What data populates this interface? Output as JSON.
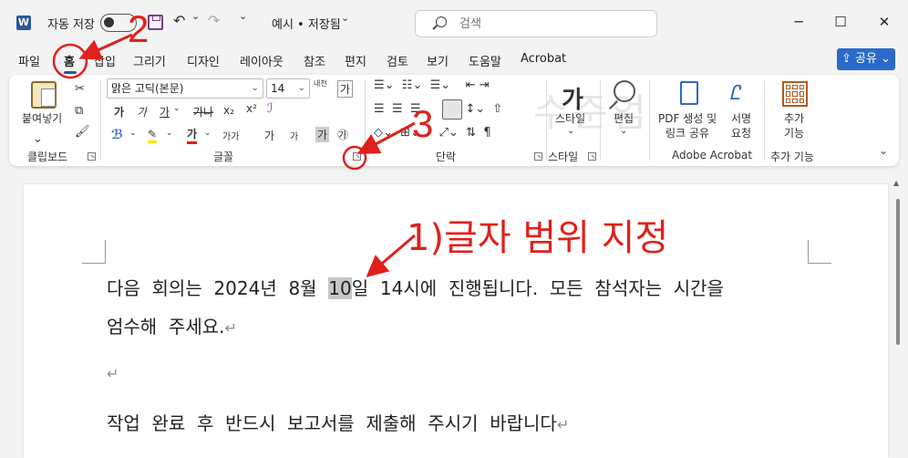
{
  "titlebar": {
    "app_logo": "W",
    "autosave_label": "자동 저장",
    "autosave_state": "off",
    "doc_title": "예시 • 저장됨",
    "search_placeholder": "검색",
    "icons": {
      "save": "save-icon",
      "undo": "↶",
      "undo_dropdown": "⌄",
      "redo": "↷",
      "customize": "⌄",
      "title_dropdown": "⌄",
      "minimize": "─",
      "maximize": "☐",
      "close": "✕"
    }
  },
  "tabs": [
    {
      "label": "파일"
    },
    {
      "label": "홈",
      "active": true
    },
    {
      "label": "삽입"
    },
    {
      "label": "그리기"
    },
    {
      "label": "디자인"
    },
    {
      "label": "레이아웃"
    },
    {
      "label": "참조"
    },
    {
      "label": "편지"
    },
    {
      "label": "검토"
    },
    {
      "label": "보기"
    },
    {
      "label": "도움말"
    },
    {
      "label": "Acrobat"
    }
  ],
  "share_label": "공유",
  "ribbon": {
    "clipboard": {
      "group_label": "클립보드",
      "paste_label": "붙여넣기"
    },
    "font": {
      "group_label": "글꼴",
      "font_name": "맑은 고딕(본문)",
      "font_size": "14",
      "row2": [
        "가",
        "가",
        "가",
        "가나",
        "x₂",
        "x²"
      ],
      "row3": [
        "가가",
        "가",
        "가",
        "가",
        "가",
        "㉮"
      ],
      "grow": "내천",
      "clear": "가"
    },
    "paragraph": {
      "group_label": "단락"
    },
    "styles": {
      "group_label": "스타일",
      "styles_label": "스타일",
      "edit_label": "편집"
    },
    "adobe": {
      "group_label": "Adobe Acrobat",
      "pdf_label_1": "PDF 생성 및",
      "pdf_label_2": "링크 공유",
      "sign_label_1": "서명",
      "sign_label_2": "요청"
    },
    "addins": {
      "group_label": "추가 기능",
      "label_1": "추가",
      "label_2": "기능"
    }
  },
  "document": {
    "para1_pre": "다음  회의는  2024년  8월  ",
    "para1_selected": "10",
    "para1_post": "일  14시에  진행됩니다.  모든  참석자는  시간을",
    "para2": "엄수해  주세요.",
    "para4": "작업  완료  후  반드시  보고서를  제출해  주시기  바랍니다",
    "pilcrow": "↵"
  },
  "annotations": {
    "step1": "1)글자 범위 지정",
    "step2": "2",
    "step3": "3",
    "color": "#e0201b"
  },
  "colors": {
    "accent": "#2b579a",
    "share": "#2b6ac9",
    "selection": "#c6c6c6"
  }
}
